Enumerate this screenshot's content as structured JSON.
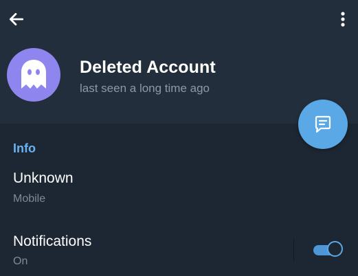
{
  "header": {
    "back_icon": "arrow-left-icon",
    "menu_icon": "more-vertical-icon",
    "avatar_icon": "ghost-icon",
    "name": "Deleted Account",
    "status": "last seen a long time ago",
    "fab_icon": "message-icon"
  },
  "info": {
    "title": "Info",
    "phone_value": "Unknown",
    "phone_label": "Mobile"
  },
  "notifications": {
    "title": "Notifications",
    "state": "On",
    "enabled": true
  },
  "colors": {
    "background": "#1d2733",
    "header": "#232e3c",
    "accent": "#6ab3f3",
    "avatar": "#8e85ee",
    "fab": "#5aa9e6"
  }
}
